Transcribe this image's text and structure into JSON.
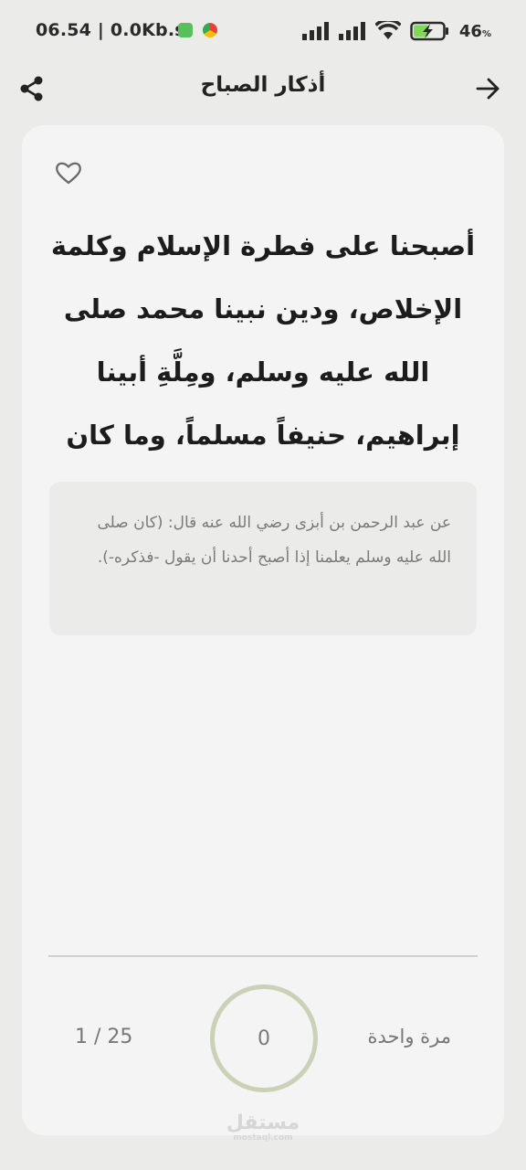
{
  "status_bar": {
    "time_speed": "06.54 | 0.0Kb.s",
    "battery": "46",
    "battery_unit": "%"
  },
  "header": {
    "title": "أذكار الصباح",
    "share_icon": "share-icon",
    "back_icon": "arrow-right-icon"
  },
  "card": {
    "favorite_icon": "heart-outline-icon",
    "dhikr_text": "أصبحنا على فطرة الإسلام وكلمة الإخلاص، ودين نبينا محمد صلى الله عليه وسلم، ومِلَّةِ أبينا إبراهيم، حنيفاً مسلماً، وما كان من المشركين.",
    "source_text": "عن عبد الرحمن بن أبزى رضي الله عنه قال: (كان صلى الله عليه وسلم يعلمنا إذا أصبح أحدنا أن يقول -فذكره-).",
    "repeat_label": "مرة واحدة",
    "counter_value": "0",
    "progress": "1 / 25"
  },
  "watermark": {
    "main": "مستقل",
    "sub": "mostaql.com"
  },
  "colors": {
    "background": "#ebecea",
    "card": "#f4f4f4",
    "counter_ring": "#c9d2b6",
    "battery_fill": "#7ed957"
  }
}
